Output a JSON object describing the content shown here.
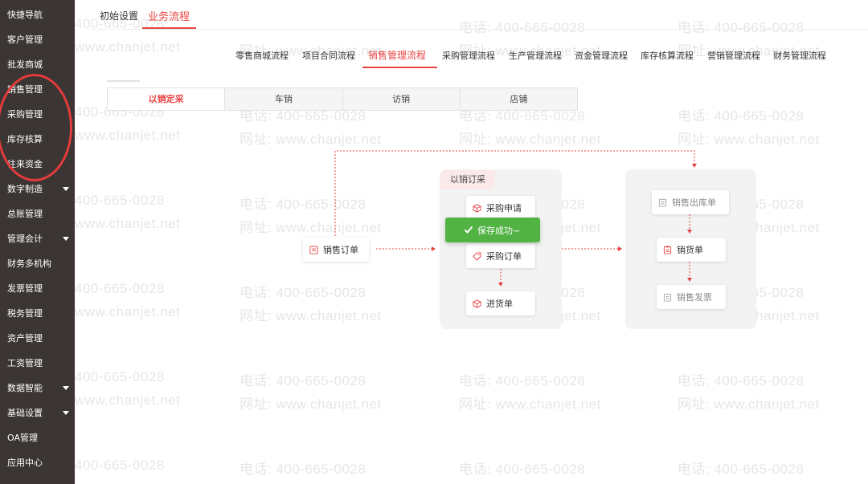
{
  "sidebar": {
    "items": [
      {
        "label": "快捷导航"
      },
      {
        "label": "客户管理"
      },
      {
        "label": "批发商城"
      },
      {
        "label": "销售管理"
      },
      {
        "label": "采购管理"
      },
      {
        "label": "库存核算"
      },
      {
        "label": "往来资金"
      },
      {
        "label": "数字制造",
        "expandable": true
      },
      {
        "label": "总账管理"
      },
      {
        "label": "管理会计",
        "expandable": true
      },
      {
        "label": "财务多机构"
      },
      {
        "label": "发票管理"
      },
      {
        "label": "税务管理"
      },
      {
        "label": "资产管理"
      },
      {
        "label": "工资管理"
      },
      {
        "label": "数据智能",
        "expandable": true
      },
      {
        "label": "基础设置",
        "expandable": true
      },
      {
        "label": "OA管理"
      },
      {
        "label": "应用中心"
      }
    ]
  },
  "top_tabs": [
    "初始设置",
    "业务流程"
  ],
  "process_tabs": [
    "零售商城流程",
    "项目合同流程",
    "销售管理流程",
    "采购管理流程",
    "生产管理流程",
    "资金管理流程",
    "库存核算流程",
    "营销管理流程",
    "财务管理流程"
  ],
  "sub_tabs": [
    "以销定采",
    "车销",
    "访销",
    "店铺"
  ],
  "flow": {
    "start_node": "销售订单",
    "middle_panel_label": "以销订采",
    "middle_nodes": [
      "采购申请",
      "采购订单",
      "进货单"
    ],
    "right_nodes": [
      "销售出库单",
      "销货单",
      "销售发票"
    ],
    "toast": "保存成功~"
  },
  "watermark": {
    "phone": "电话: 400-665-0028",
    "site": "网址: www.chanjet.net",
    "phone_partial": "400-665-0028",
    "site_partial": "www.chanjet.net"
  },
  "colors": {
    "accent": "#e84343",
    "sidebar_bg": "#3b3533",
    "toast_bg": "#52b344"
  }
}
